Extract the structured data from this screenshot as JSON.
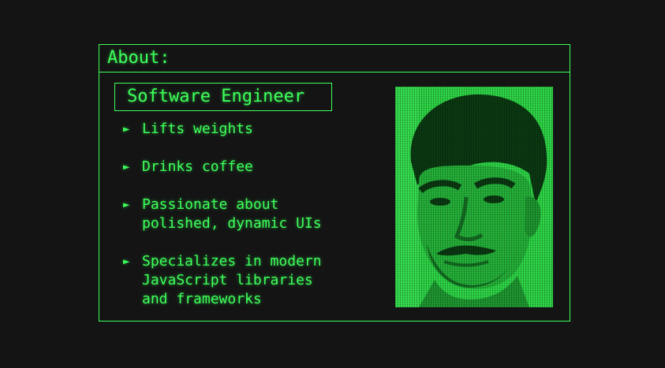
{
  "panel": {
    "title": "About:",
    "role": "Software Engineer",
    "bullet_symbol": "►",
    "traits": [
      {
        "lines": [
          "Lifts weights"
        ]
      },
      {
        "lines": [
          "Drinks coffee"
        ]
      },
      {
        "lines": [
          "Passionate about",
          "polished, dynamic UIs"
        ]
      },
      {
        "lines": [
          "Specializes in modern",
          "JavaScript libraries",
          "and frameworks"
        ]
      }
    ],
    "portrait_icon": "person-portrait"
  },
  "colors": {
    "background": "#141414",
    "accent": "#3dff5a",
    "portrait_base": "#2fd948",
    "portrait_shadow": "#0b3a12"
  }
}
